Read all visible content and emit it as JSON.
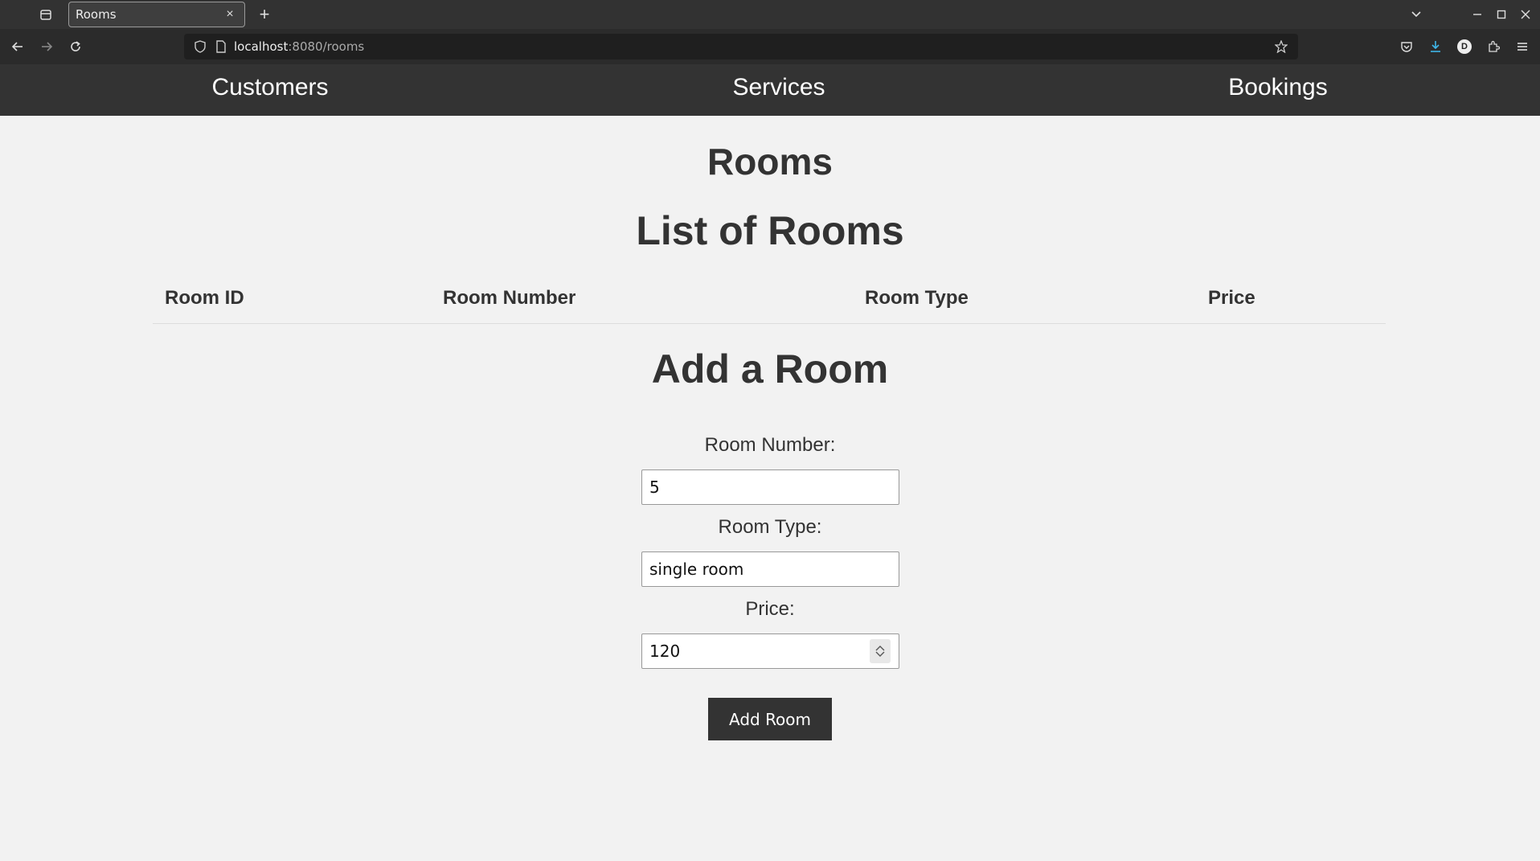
{
  "browser": {
    "tab_title": "Rooms",
    "tab_close": "×",
    "new_tab": "+",
    "url_host": "localhost",
    "url_path": ":8080/rooms",
    "profile_initial": "D"
  },
  "nav": {
    "items": [
      {
        "label": "Customers"
      },
      {
        "label": "Services"
      },
      {
        "label": "Bookings"
      }
    ]
  },
  "page": {
    "title": "Rooms",
    "list_title": "List of Rooms",
    "table": {
      "headers": [
        "Room ID",
        "Room Number",
        "Room Type",
        "Price"
      ],
      "rows": []
    },
    "add_title": "Add a Room"
  },
  "form": {
    "room_number_label": "Room Number:",
    "room_number_value": "5",
    "room_type_label": "Room Type:",
    "room_type_value": "single room",
    "price_label": "Price:",
    "price_value": "120",
    "submit_label": "Add Room"
  },
  "colors": {
    "nav_bg": "#333333",
    "page_bg": "#f2f2f2",
    "button_bg": "#333333"
  }
}
